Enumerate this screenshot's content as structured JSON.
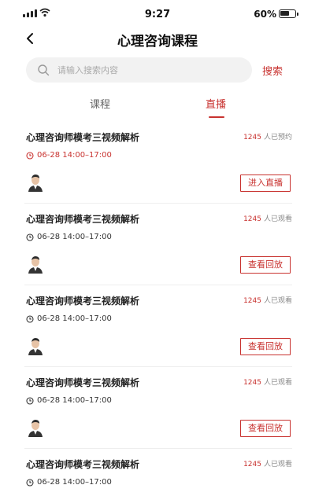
{
  "status_bar": {
    "time": "9:27",
    "battery": "60%"
  },
  "nav": {
    "title": "心理咨询课程"
  },
  "search": {
    "placeholder": "请输入搜索内容",
    "value": "",
    "button_label": "搜索"
  },
  "tabs": [
    {
      "label": "课程",
      "active": false
    },
    {
      "label": "直播",
      "active": true
    }
  ],
  "courses": [
    {
      "title": "心理咨询师模考三视频解析",
      "count": "1245",
      "count_suffix": "人已预约",
      "time": "06-28  14:00–17:00",
      "action": "进入直播",
      "live": true
    },
    {
      "title": "心理咨询师模考三视频解析",
      "count": "1245",
      "count_suffix": "人已观看",
      "time": "06-28  14:00–17:00",
      "action": "查看回放",
      "live": false
    },
    {
      "title": "心理咨询师模考三视频解析",
      "count": "1245",
      "count_suffix": "人已观看",
      "time": "06-28  14:00–17:00",
      "action": "查看回放",
      "live": false
    },
    {
      "title": "心理咨询师模考三视频解析",
      "count": "1245",
      "count_suffix": "人已观看",
      "time": "06-28  14:00–17:00",
      "action": "查看回放",
      "live": false
    },
    {
      "title": "心理咨询师模考三视频解析",
      "count": "1245",
      "count_suffix": "人已观看",
      "time": "06-28  14:00–17:00",
      "action": "",
      "live": false
    }
  ],
  "colors": {
    "accent": "#c8322f",
    "divider": "#eeeeee",
    "search_bg": "#f2f2f2"
  },
  "icons": {
    "back": "chevron-left-icon",
    "search": "search-icon",
    "clock": "clock-icon",
    "avatar": "avatar"
  }
}
